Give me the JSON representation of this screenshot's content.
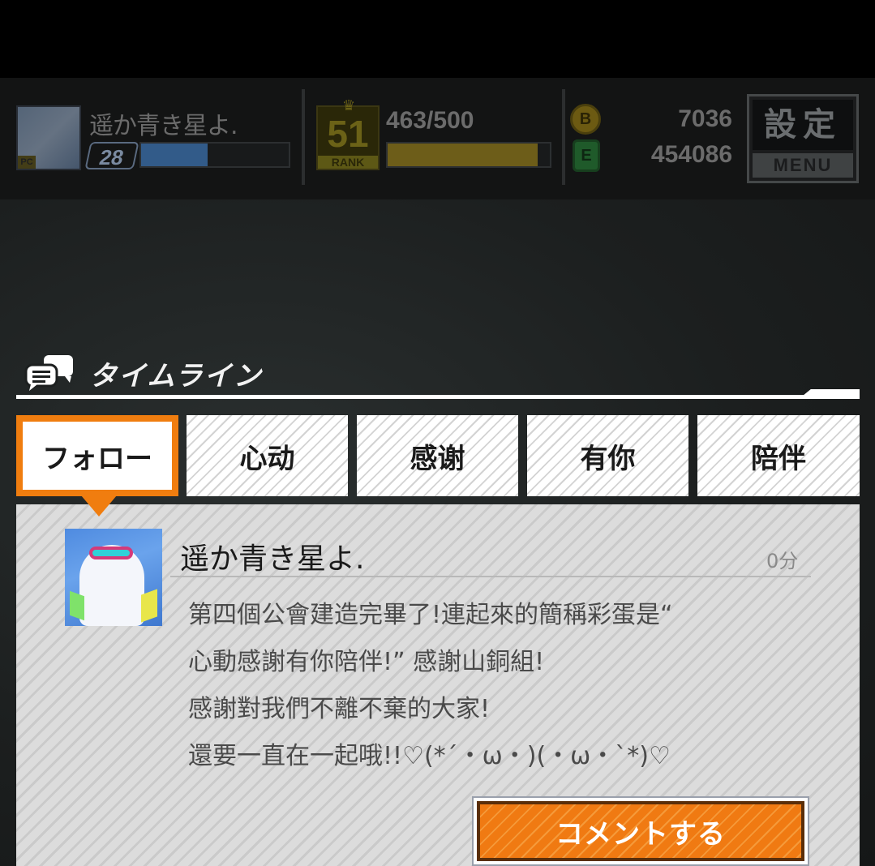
{
  "hud": {
    "player_name": "遥か青き星よ.",
    "player_level": "28",
    "avatar_badge": "PC",
    "exp_progress": 0.45,
    "rank_number": "51",
    "rank_label": "RANK",
    "rank_progress_text": "463/500",
    "rank_progress": 0.926,
    "coin_icon_label": "B",
    "coin_value": "7036",
    "gem_icon_label": "E",
    "gem_value": "454086",
    "settings_kanji": "設定",
    "settings_menu": "MENU"
  },
  "timeline": {
    "title": "タイムライン",
    "tabs": [
      {
        "label": "フォロー",
        "active": true
      },
      {
        "label": "心动",
        "active": false
      },
      {
        "label": "感谢",
        "active": false
      },
      {
        "label": "有你",
        "active": false
      },
      {
        "label": "陪伴",
        "active": false
      }
    ]
  },
  "post": {
    "author": "遥か青き星よ.",
    "time": "0分",
    "lines": [
      "第四個公會建造完畢了!連起來的簡稱彩蛋是“",
      "心動感謝有你陪伴!”  感謝山銅組!",
      "感謝對我們不離不棄的大家!",
      "還要一直在一起哦!!♡(*´・ω・)(・ω・`*)♡"
    ],
    "comment_button": "コメントする"
  },
  "colors": {
    "accent_orange": "#f07d0f",
    "background": "#1c1f1f"
  }
}
